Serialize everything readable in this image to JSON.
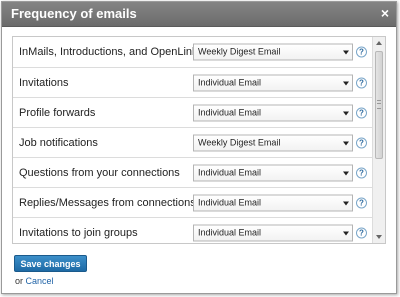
{
  "dialog": {
    "title": "Frequency of emails",
    "close_symbol": "×"
  },
  "settings": [
    {
      "label": "InMails, Introductions, and OpenLink",
      "value": "Weekly Digest Email"
    },
    {
      "label": "Invitations",
      "value": "Individual Email"
    },
    {
      "label": "Profile forwards",
      "value": "Individual Email"
    },
    {
      "label": "Job notifications",
      "value": "Weekly Digest Email"
    },
    {
      "label": "Questions from your connections",
      "value": "Individual Email"
    },
    {
      "label": "Replies/Messages from connections",
      "value": "Individual Email"
    },
    {
      "label": "Invitations to join groups",
      "value": "Individual Email"
    }
  ],
  "help_symbol": "?",
  "footer": {
    "save_label": "Save changes",
    "or_text": "or",
    "cancel_label": "Cancel"
  },
  "colors": {
    "titlebar": "#777777",
    "button": "#2b7bbb",
    "link": "#2164a7"
  }
}
